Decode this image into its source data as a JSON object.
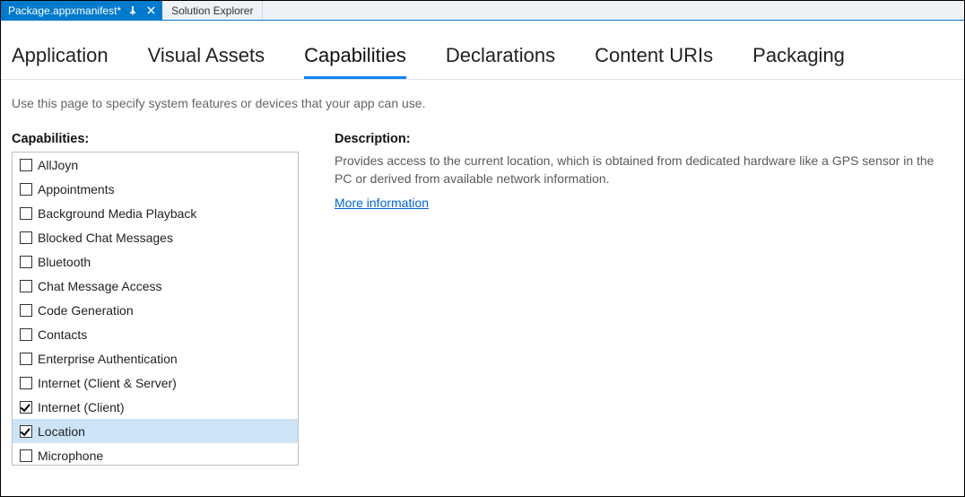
{
  "tabStrip": {
    "active": "Package.appxmanifest*",
    "inactive": [
      "Solution Explorer"
    ]
  },
  "manifest_tabs": [
    {
      "label": "Application",
      "active": false
    },
    {
      "label": "Visual Assets",
      "active": false
    },
    {
      "label": "Capabilities",
      "active": true
    },
    {
      "label": "Declarations",
      "active": false
    },
    {
      "label": "Content URIs",
      "active": false
    },
    {
      "label": "Packaging",
      "active": false
    }
  ],
  "help_text": "Use this page to specify system features or devices that your app can use.",
  "caps_heading": "Capabilities:",
  "capabilities": [
    {
      "label": "AllJoyn",
      "checked": false,
      "selected": false
    },
    {
      "label": "Appointments",
      "checked": false,
      "selected": false
    },
    {
      "label": "Background Media Playback",
      "checked": false,
      "selected": false
    },
    {
      "label": "Blocked Chat Messages",
      "checked": false,
      "selected": false
    },
    {
      "label": "Bluetooth",
      "checked": false,
      "selected": false
    },
    {
      "label": "Chat Message Access",
      "checked": false,
      "selected": false
    },
    {
      "label": "Code Generation",
      "checked": false,
      "selected": false
    },
    {
      "label": "Contacts",
      "checked": false,
      "selected": false
    },
    {
      "label": "Enterprise Authentication",
      "checked": false,
      "selected": false
    },
    {
      "label": "Internet (Client & Server)",
      "checked": false,
      "selected": false
    },
    {
      "label": "Internet (Client)",
      "checked": true,
      "selected": false
    },
    {
      "label": "Location",
      "checked": true,
      "selected": true
    },
    {
      "label": "Microphone",
      "checked": false,
      "selected": false
    }
  ],
  "desc_heading": "Description:",
  "description": "Provides access to the current location, which is obtained from dedicated hardware like a GPS sensor in the PC or derived from available network information.",
  "more_link": "More information"
}
